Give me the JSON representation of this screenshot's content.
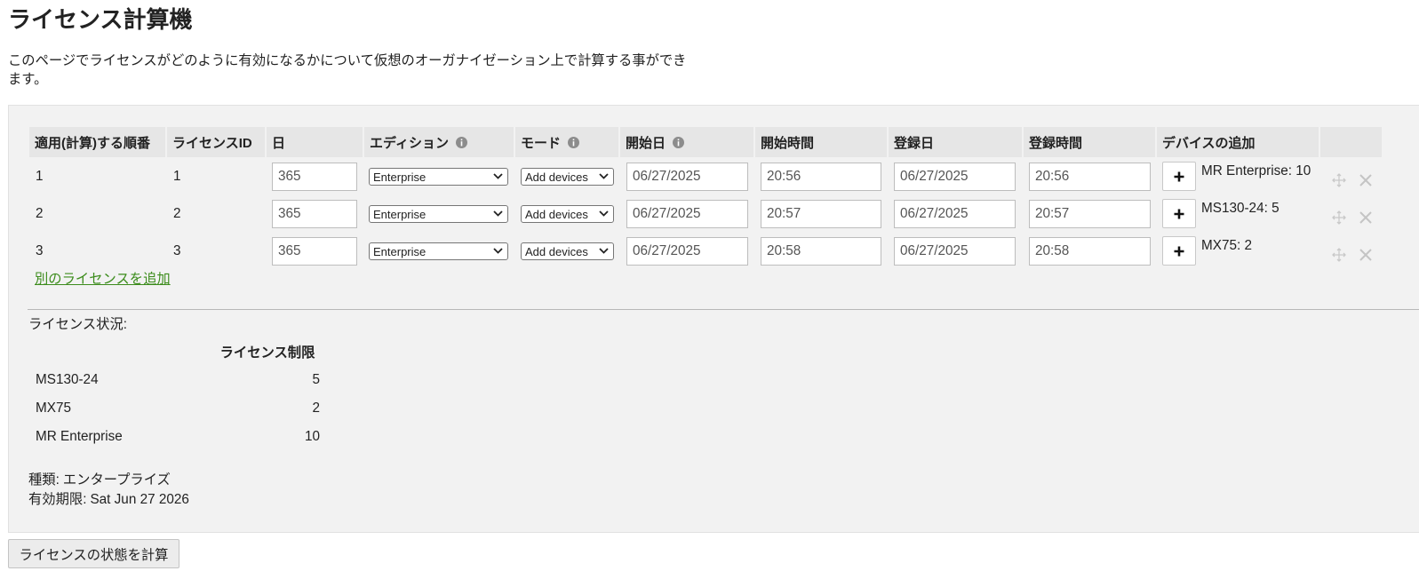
{
  "page": {
    "title": "ライセンス計算機",
    "description": "このページでライセンスがどのように有効になるかについて仮想のオーガナイゼーション上で計算する事ができます。"
  },
  "table": {
    "headers": {
      "order": "適用(計算)する順番",
      "license_id": "ライセンスID",
      "days": "日",
      "edition": "エディション",
      "mode": "モード",
      "start_date": "開始日",
      "start_time": "開始時間",
      "registration_date": "登録日",
      "registration_time": "登録時間",
      "add_devices": "デバイスの追加"
    },
    "rows": [
      {
        "order": "1",
        "license_id": "1",
        "days": "365",
        "edition": "Enterprise",
        "mode": "Add devices",
        "start_date": "06/27/2025",
        "start_time": "20:56",
        "registration_date": "06/27/2025",
        "registration_time": "20:56",
        "devices": "MR Enterprise: 10"
      },
      {
        "order": "2",
        "license_id": "2",
        "days": "365",
        "edition": "Enterprise",
        "mode": "Add devices",
        "start_date": "06/27/2025",
        "start_time": "20:57",
        "registration_date": "06/27/2025",
        "registration_time": "20:57",
        "devices": "MS130-24: 5"
      },
      {
        "order": "3",
        "license_id": "3",
        "days": "365",
        "edition": "Enterprise",
        "mode": "Add devices",
        "start_date": "06/27/2025",
        "start_time": "20:58",
        "registration_date": "06/27/2025",
        "registration_time": "20:58",
        "devices": "MX75: 2"
      }
    ]
  },
  "add_license_link": "別のライセンスを追加",
  "status": {
    "label": "ライセンス状況:",
    "limit_header": "ライセンス制限",
    "limits": [
      {
        "device": "MS130-24",
        "limit": "5"
      },
      {
        "device": "MX75",
        "limit": "2"
      },
      {
        "device": "MR Enterprise",
        "limit": "10"
      }
    ],
    "type": {
      "label": "種類:",
      "value": "エンタープライズ"
    },
    "expiry": {
      "label": "有効期限:",
      "value": "Sat Jun 27 2026"
    }
  },
  "calculate_button": "ライセンスの状態を計算",
  "icons": {
    "header_info": "info-icon",
    "dropdown": "chevron-down-icon",
    "add_device": "plus-icon",
    "reorder": "move-icon",
    "remove": "close-icon"
  },
  "colors": {
    "panel_background": "#f2f2f2",
    "header_background": "#e6e6e6",
    "link": "#3c8c1c",
    "row_action_icon": "#c6c6c6",
    "button_background": "#ececec"
  }
}
